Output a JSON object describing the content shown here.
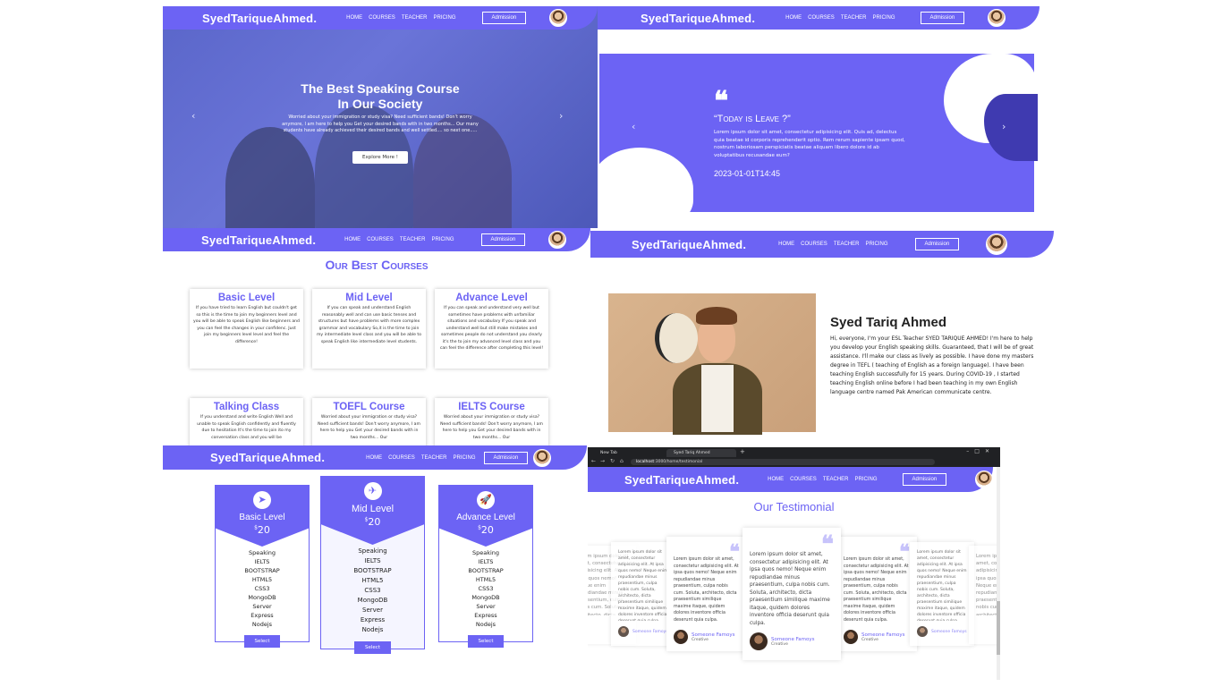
{
  "brand": "SyedTariqueAhmed.",
  "nav": {
    "home": "HOME",
    "courses": "COURSES",
    "teacher": "TEACHER",
    "pricing": "PRICING",
    "admission": "Admission"
  },
  "hero": {
    "title_line1": "The Best Speaking Course",
    "title_line2": "In Our Society",
    "text": "Worried about your immigration or study visa? Need sufficient bands! Don't worry anymore, I am here to help you Get your desired bands with in two months... Our many students have already achieved their desired bands and well settled.... so next one.....",
    "button": "Explore More !"
  },
  "slide": {
    "title": "“Today is Leave ?”",
    "body": "Lorem ipsum dolor sit amet, consectetur adipisicing elit. Quis ad, delectus quia beatae id corporis reprehenderit optio. Rem rerum sapiente ipsam quod, nostrum laboriosam perspiciatis beatae aliquam libero dolore id ab voluptatibus recusandae eum?",
    "date": "2023-01-01T14:45"
  },
  "courses": {
    "title": "Our Best Courses",
    "items": [
      {
        "name": "Basic Level",
        "text": "If you have tried to learn English but couldn't get so this is the time to join my beginners level and you will be able to speak English like beginners and you can feel the changes in your confidenc. Just join my beginners level level and feel the difference!"
      },
      {
        "name": "Mid Level",
        "text": "If you can speak and understand English reasonably well and can use basic tenses and structures but have problems with more complex grammar and vocabulary So,it is the time to join my intermediate level class and you will be able to speak English like intermediate level students."
      },
      {
        "name": "Advance Level",
        "text": "If you can speak and understand very well but sometimes have problems with unfamiliar situations and vocabulary If you speak and understand well but still make mistakes and sometimes people do not understand you clearly it's the to join my advanced level class and you can feel the difference after completing this level!"
      },
      {
        "name": "Talking Class",
        "text": "If you understand and write English Well and unable to speak English confidently and fluently due to hesitation It's the time to join ito my conversation class and you will be"
      },
      {
        "name": "TOEFL Course",
        "text": "Worried about your immigration or study visa? Need sufficient bands! Don't worry anymore, I am here to help you Get your desired bands with in two months... Our"
      },
      {
        "name": "IELTS Course",
        "text": "Worried about your immigration or study visa? Need sufficient bands! Don't worry anymore, I am here to help you Get your desired bands with in two months... Our"
      }
    ]
  },
  "about": {
    "name": "Syed Tariq Ahmed",
    "text": "Hi, everyone, I'm your ESL Teacher SYED TARIQUE AHMED! I'm here to help you develop your English speaking skills. Guaranteed, that I will be of great assistance. I'll make our class as lively as possible. I have done my masters degree in TEFL ( teaching of English as a foreign language). I have been teaching English successfully for 15 years. During COVID-19 , I started teaching English online before I had been teaching in my own English language centre named Pak American communicate centre."
  },
  "pricing": {
    "features": [
      "Speaking",
      "IELTS",
      "BOOTSTRAP",
      "HTML5",
      "CSS3",
      "MongoDB",
      "Server",
      "Express",
      "Nodejs"
    ],
    "plans": [
      {
        "name": "Basic Level",
        "price": "20",
        "currency": "$",
        "button": "Select",
        "icon": "paper-plane-icon"
      },
      {
        "name": "Mid Level",
        "price": "20",
        "currency": "$",
        "button": "Select",
        "icon": "airplane-icon"
      },
      {
        "name": "Advance Level",
        "price": "20",
        "currency": "$",
        "button": "Select",
        "icon": "rocket-icon"
      }
    ]
  },
  "browser": {
    "tab1": "New Tab",
    "tab2": "Syed Tariq Ahmed",
    "url_host": "localhost",
    "url_path": ":3000/home/testimonial"
  },
  "testimonial": {
    "title": "Our Testimonial",
    "text": "Lorem ipsum dolor sit amet, consectetur adipisicing elit. At ipsa quos nemo! Neque enim repudiandae minus praesentium, culpa nobis cum. Soluta, architecto, dicta praesentium similique maxime itaque, quidem dolores inventore officia deserunt quia culpa.",
    "author": "Someone Famoys",
    "role": "Creative"
  },
  "colors": {
    "accent": "#6c63f4"
  }
}
